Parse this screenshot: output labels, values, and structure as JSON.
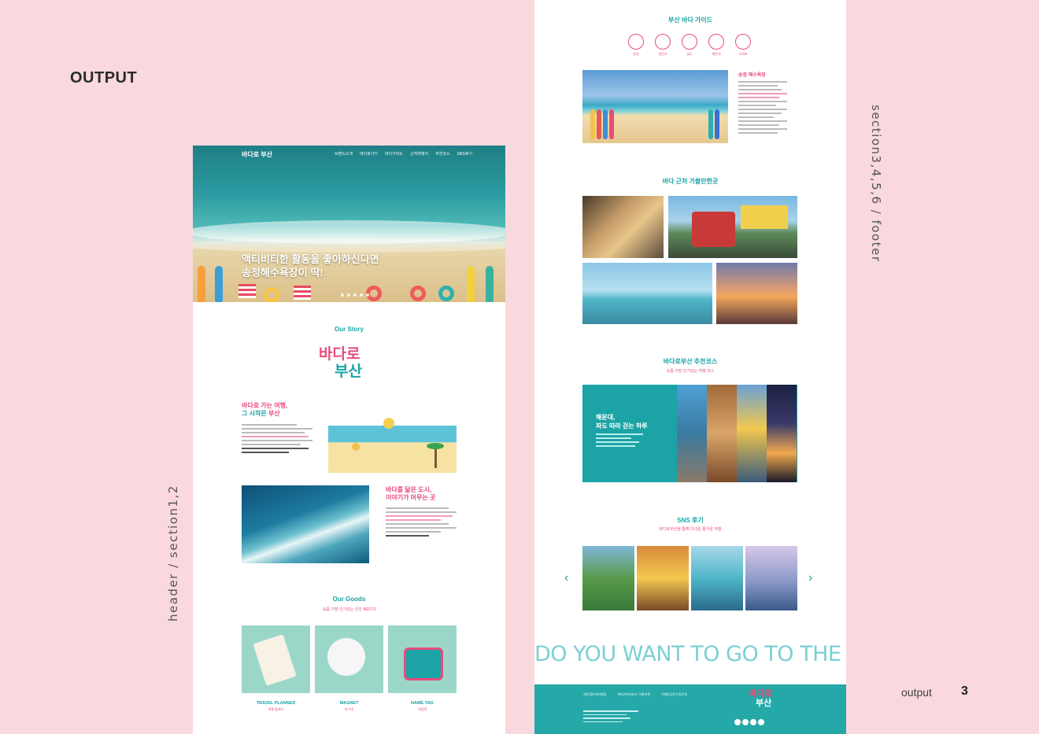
{
  "portfolio": {
    "title": "OUTPUT",
    "left_caption": "header / section1,2",
    "right_caption": "section3,4,5,6 / footer",
    "page_label": "output",
    "page_number": "3"
  },
  "left": {
    "logo": "바다로 부산",
    "nav": [
      "브랜드소개",
      "바다로가기",
      "바다가이드",
      "근처여행지",
      "추천코스",
      "SNS후기"
    ],
    "hero_text_line1": "액티비티한 활동을 좋아하신다면",
    "hero_text_line2": "송정해수욕장이 딱!",
    "story_title": "Our Story",
    "big_logo_line1": "바다로",
    "big_logo_line2": "부산",
    "block1_line1": "바다로 가는 여행,",
    "block1_line2_a": "그 시작은 ",
    "block1_line2_b": "부산",
    "block2_line1": "바다를 닮은 도시,",
    "block2_line2": "이야기가 머무는 곳",
    "goods_title": "Our Goods",
    "goods_subtitle": "요즘 가장 인기있는 굿즈 BEST3",
    "goods": [
      {
        "name": "TRAVEL PLANNER",
        "sub": "여행 플래너"
      },
      {
        "name": "MAGNET",
        "sub": "마그넷"
      },
      {
        "name": "NAME TAG",
        "sub": "네임택"
      }
    ]
  },
  "right": {
    "guide_title": "부산 바다 가이드",
    "guide_icons": [
      {
        "icon": "surf-icon",
        "label": "송정"
      },
      {
        "icon": "beach-icon",
        "label": "광안리"
      },
      {
        "icon": "wave-icon",
        "label": "송도"
      },
      {
        "icon": "train-icon",
        "label": "해운대"
      },
      {
        "icon": "lighthouse-icon",
        "label": "다대포"
      }
    ],
    "beach_heading": "송정 해수욕장",
    "nearby_title": "바다 근처 가볼만한곳",
    "course_title": "바다로부산 추천코스",
    "course_subtitle": "요즘 가장 인기있는 여행 코스",
    "course_heading_line1": "해운대,",
    "course_heading_line2": "파도 따라 걷는 하루",
    "sns_title": "SNS 후기",
    "sns_subtitle": "바다로부산을 통해 다녀온 즐거운 여행",
    "slogan": "DO YOU WANT TO GO TO THE",
    "footer_links": [
      "개인정보처리방침",
      "위치기반서비스 이용약관",
      "이메일무단수집거부"
    ],
    "footer_logo_line1": "바다로",
    "footer_logo_line2": "부산"
  },
  "colors": {
    "background": "#f9d9de",
    "teal": "#1ba3a6",
    "pink": "#e94b7b"
  }
}
